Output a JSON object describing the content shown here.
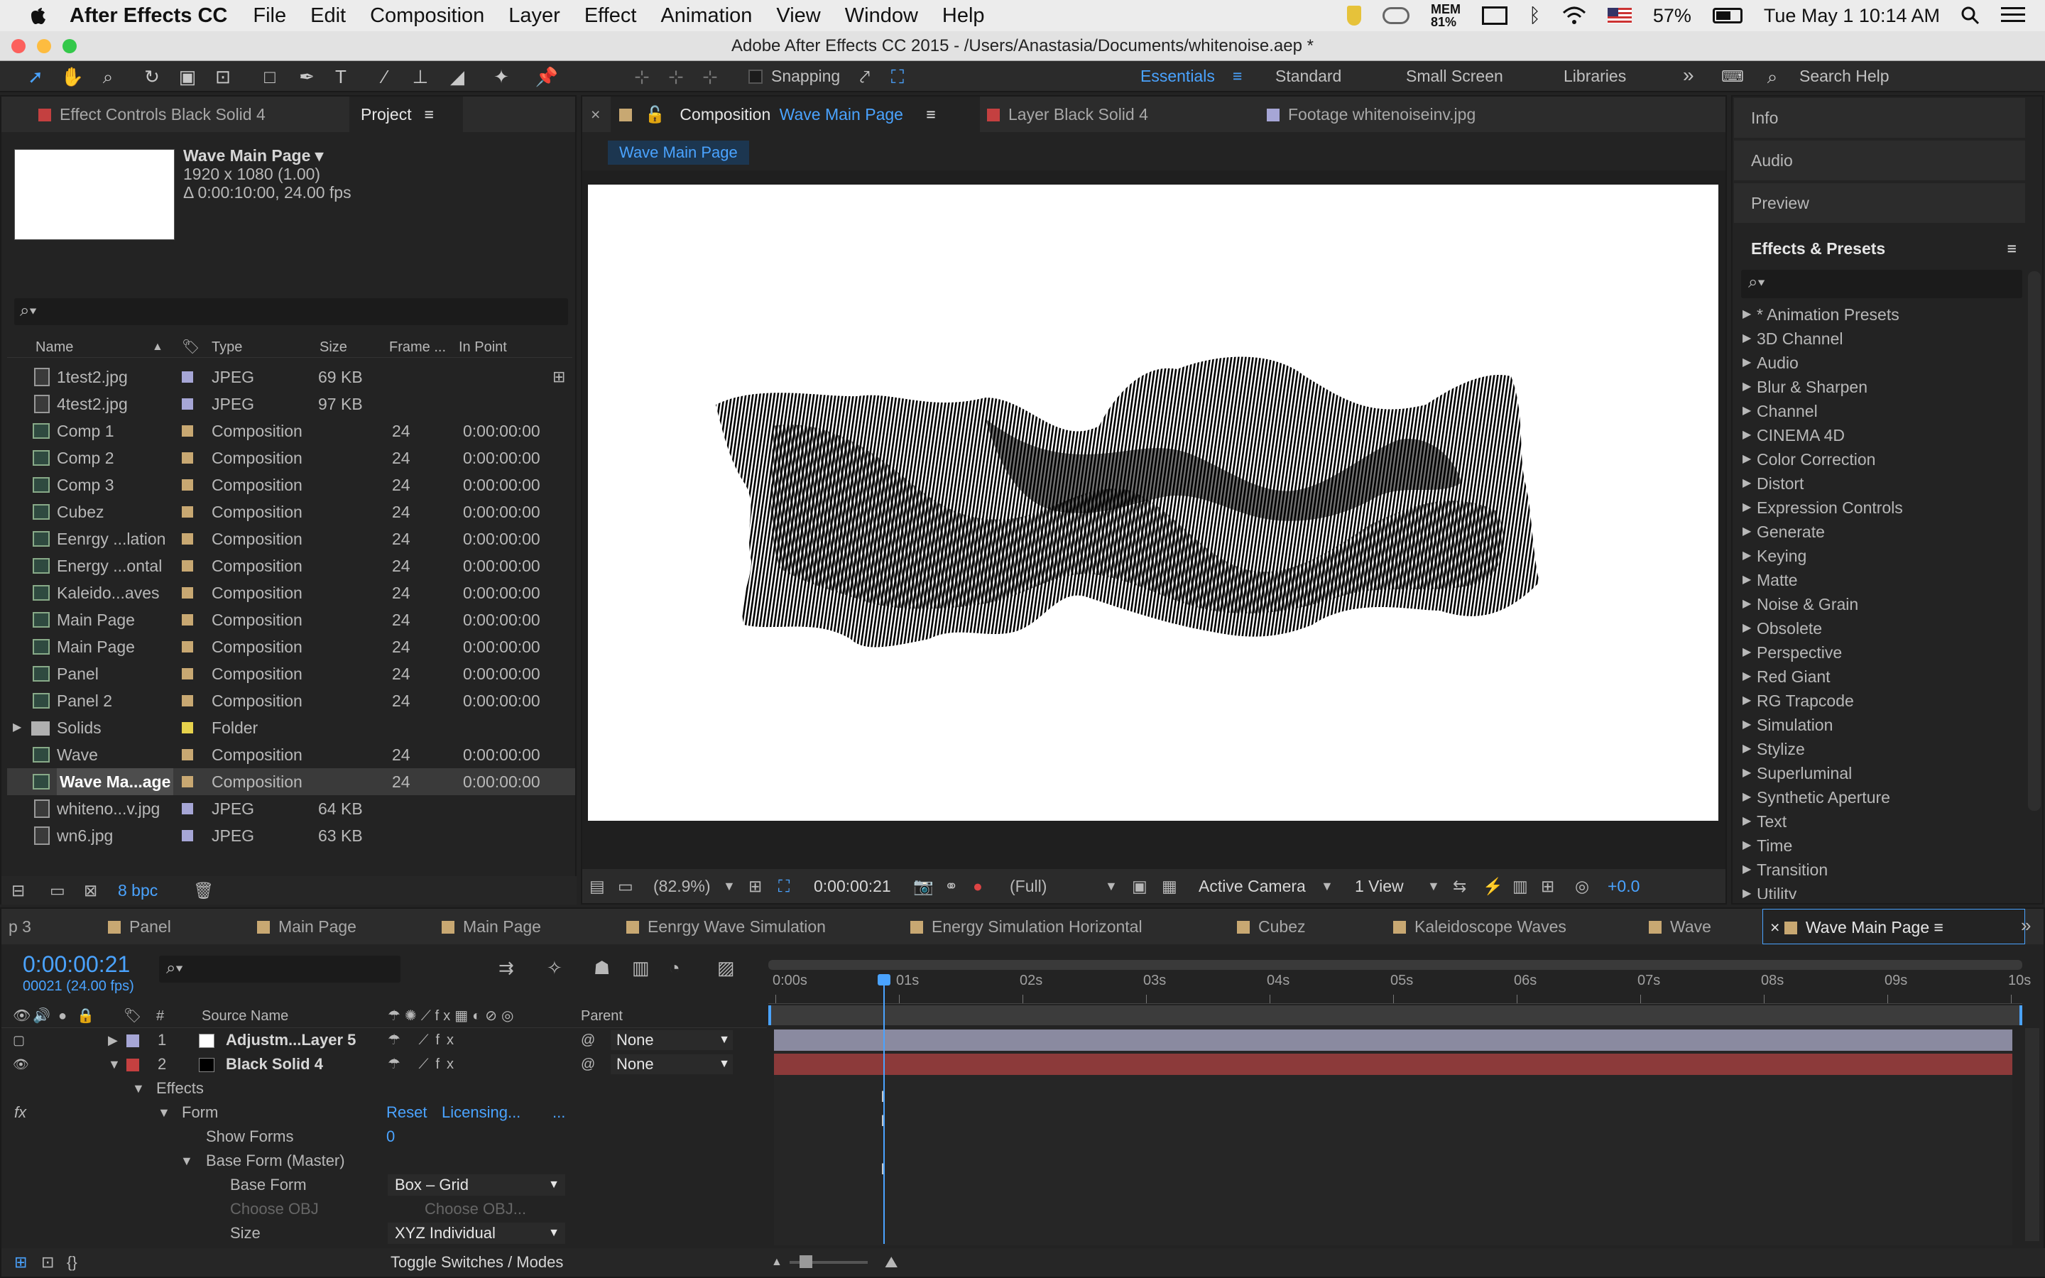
{
  "menubar": {
    "apple": "",
    "app_name": "After Effects CC",
    "items": [
      "File",
      "Edit",
      "Composition",
      "Layer",
      "Effect",
      "Animation",
      "View",
      "Window",
      "Help"
    ],
    "mem_label": "MEM",
    "mem_value": "81%",
    "battery": "57%",
    "datetime": "Tue May 1  10:14 AM"
  },
  "window": {
    "title": "Adobe After Effects CC 2015 - /Users/Anastasia/Documents/whitenoise.aep *"
  },
  "toolbar": {
    "snapping": "Snapping",
    "workspaces": [
      "Essentials",
      "Standard",
      "Small Screen",
      "Libraries"
    ],
    "more": "»",
    "search_help": "Search Help"
  },
  "left_panel": {
    "tabs": [
      "Effect Controls Black Solid 4",
      "Project"
    ],
    "preview_name": "Wave Main Page ▾",
    "preview_size": "1920 x 1080 (1.00)",
    "preview_duration": "Δ 0:00:10:00, 24.00 fps",
    "columns": [
      "Name",
      "Type",
      "Size",
      "Frame ...",
      "In Point"
    ],
    "items": [
      {
        "name": "1test2.jpg",
        "kind": "file",
        "color": "#a6a6d6",
        "type": "JPEG",
        "size": "69 KB",
        "fps": "",
        "in": ""
      },
      {
        "name": "4test2.jpg",
        "kind": "file",
        "color": "#a6a6d6",
        "type": "JPEG",
        "size": "97 KB",
        "fps": "",
        "in": ""
      },
      {
        "name": "Comp 1",
        "kind": "comp",
        "color": "#c8a872",
        "type": "Composition",
        "size": "",
        "fps": "24",
        "in": "0:00:00:00"
      },
      {
        "name": "Comp 2",
        "kind": "comp",
        "color": "#c8a872",
        "type": "Composition",
        "size": "",
        "fps": "24",
        "in": "0:00:00:00"
      },
      {
        "name": "Comp 3",
        "kind": "comp",
        "color": "#c8a872",
        "type": "Composition",
        "size": "",
        "fps": "24",
        "in": "0:00:00:00"
      },
      {
        "name": "Cubez",
        "kind": "comp",
        "color": "#c8a872",
        "type": "Composition",
        "size": "",
        "fps": "24",
        "in": "0:00:00:00"
      },
      {
        "name": "Eenrgy ...lation",
        "kind": "comp",
        "color": "#c8a872",
        "type": "Composition",
        "size": "",
        "fps": "24",
        "in": "0:00:00:00"
      },
      {
        "name": "Energy ...ontal",
        "kind": "comp",
        "color": "#c8a872",
        "type": "Composition",
        "size": "",
        "fps": "24",
        "in": "0:00:00:00"
      },
      {
        "name": "Kaleido...aves",
        "kind": "comp",
        "color": "#c8a872",
        "type": "Composition",
        "size": "",
        "fps": "24",
        "in": "0:00:00:00"
      },
      {
        "name": "Main Page",
        "kind": "comp",
        "color": "#c8a872",
        "type": "Composition",
        "size": "",
        "fps": "24",
        "in": "0:00:00:00"
      },
      {
        "name": "Main Page",
        "kind": "comp",
        "color": "#c8a872",
        "type": "Composition",
        "size": "",
        "fps": "24",
        "in": "0:00:00:00"
      },
      {
        "name": "Panel",
        "kind": "comp",
        "color": "#c8a872",
        "type": "Composition",
        "size": "",
        "fps": "24",
        "in": "0:00:00:00"
      },
      {
        "name": "Panel 2",
        "kind": "comp",
        "color": "#c8a872",
        "type": "Composition",
        "size": "",
        "fps": "24",
        "in": "0:00:00:00"
      },
      {
        "name": "Solids",
        "kind": "folder",
        "color": "#e6d24c",
        "type": "Folder",
        "size": "",
        "fps": "",
        "in": ""
      },
      {
        "name": "Wave",
        "kind": "comp",
        "color": "#c8a872",
        "type": "Composition",
        "size": "",
        "fps": "24",
        "in": "0:00:00:00"
      },
      {
        "name": "Wave Ma...age",
        "kind": "comp",
        "color": "#c8a872",
        "type": "Composition",
        "size": "",
        "fps": "24",
        "in": "0:00:00:00",
        "selected": true
      },
      {
        "name": "whiteno...v.jpg",
        "kind": "file",
        "color": "#a6a6d6",
        "type": "JPEG",
        "size": "64 KB",
        "fps": "",
        "in": ""
      },
      {
        "name": "wn6.jpg",
        "kind": "file",
        "color": "#a6a6d6",
        "type": "JPEG",
        "size": "63 KB",
        "fps": "",
        "in": ""
      }
    ],
    "bpc": "8 bpc"
  },
  "comp_panel": {
    "close": "×",
    "tab_prefix": "Composition",
    "tab_name": "Wave Main Page",
    "other_tabs": [
      "Layer Black Solid 4",
      "Footage whitenoiseinv.jpg"
    ],
    "breadcrumb": "Wave Main Page",
    "zoom": "(82.9%)",
    "timecode": "0:00:00:21",
    "resolution": "(Full)",
    "camera": "Active Camera",
    "views": "1 View",
    "exposure": "+0.0"
  },
  "right_panel": {
    "collapsed": [
      "Info",
      "Audio",
      "Preview"
    ],
    "title": "Effects & Presets",
    "categories": [
      "* Animation Presets",
      "3D Channel",
      "Audio",
      "Blur & Sharpen",
      "Channel",
      "CINEMA 4D",
      "Color Correction",
      "Distort",
      "Expression Controls",
      "Generate",
      "Keying",
      "Matte",
      "Noise & Grain",
      "Obsolete",
      "Perspective",
      "Red Giant",
      "RG Trapcode",
      "Simulation",
      "Stylize",
      "Superluminal",
      "Synthetic Aperture",
      "Text",
      "Time",
      "Transition",
      "Utility"
    ]
  },
  "timeline": {
    "tabs": [
      "p 3",
      "Panel",
      "Main Page",
      "Main Page",
      "Eenrgy Wave Simulation",
      "Energy Simulation Horizontal",
      "Cubez",
      "Kaleidoscope Waves",
      "Wave",
      "Wave Main Page"
    ],
    "timecode": "0:00:00:21",
    "frame": "00021 (24.00 fps)",
    "header_source": "Source Name",
    "header_parent": "Parent",
    "ruler": [
      "0:00s",
      "01s",
      "02s",
      "03s",
      "04s",
      "05s",
      "06s",
      "07s",
      "08s",
      "09s",
      "10s"
    ],
    "playhead_fraction": 0.0875,
    "layers": [
      {
        "num": "1",
        "name": "Adjustm...Layer 5",
        "color": "#a6a6d6",
        "parent": "None",
        "swatch": "#ffffff",
        "bar": "#8a8aa0"
      },
      {
        "num": "2",
        "name": "Black Solid 4",
        "color": "#c44040",
        "parent": "None",
        "swatch": "#000000",
        "bar": "#8c3a3a"
      }
    ],
    "effects_label": "Effects",
    "fx_label": "fx",
    "form_label": "Form",
    "reset": "Reset",
    "licensing": "Licensing...",
    "ellipsis": "...",
    "show_forms": "Show Forms",
    "show_forms_value": "0",
    "base_form_master": "Base Form (Master)",
    "base_form": "Base Form",
    "base_form_value": "Box – Grid",
    "choose_obj": "Choose OBJ",
    "choose_obj_value": "Choose OBJ...",
    "size": "Size",
    "size_value": "XYZ Individual",
    "toggle": "Toggle Switches / Modes"
  }
}
